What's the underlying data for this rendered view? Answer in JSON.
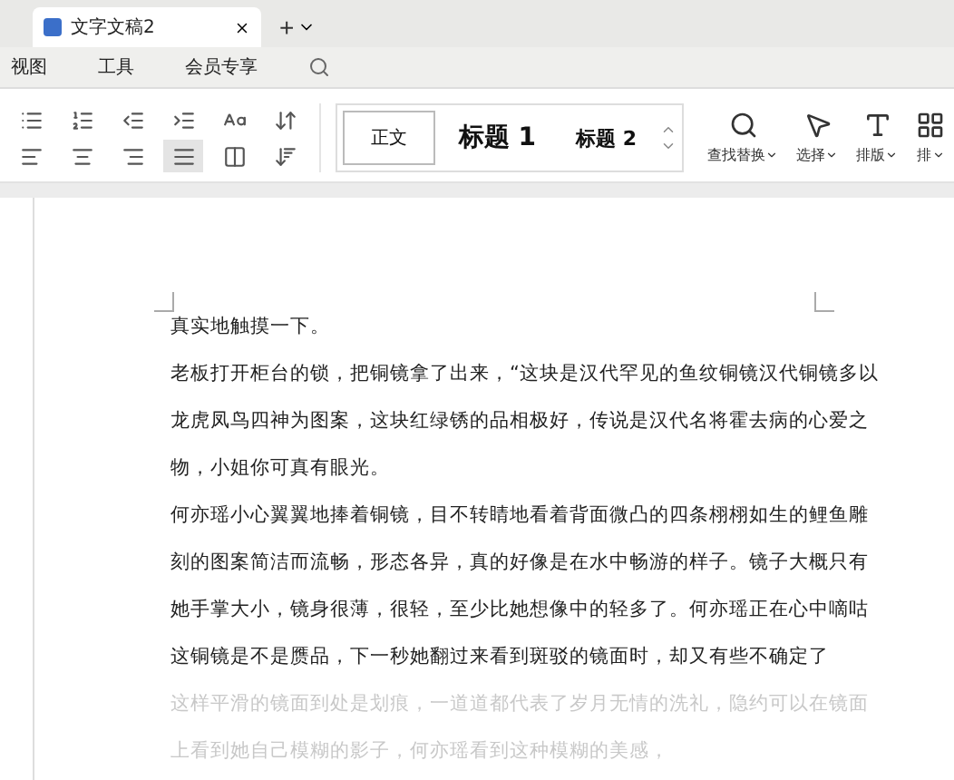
{
  "tabs": [
    {
      "label": "文字文稿2",
      "selected": true
    }
  ],
  "new_tab": "+",
  "menu": [
    {
      "label": "视图"
    },
    {
      "label": "工具"
    },
    {
      "label": "会员专享"
    }
  ],
  "styles": [
    {
      "label": "正文",
      "kind": "body",
      "selected": true
    },
    {
      "label": "标题 1",
      "kind": "h1",
      "selected": false
    },
    {
      "label": "标题 2",
      "kind": "h2",
      "selected": false
    }
  ],
  "tools": [
    {
      "label": "查找替换",
      "kind": "search"
    },
    {
      "label": "选择",
      "kind": "select"
    },
    {
      "label": "排版",
      "kind": "layout"
    },
    {
      "label": "排",
      "kind": "arrange"
    }
  ],
  "paragraphs": [
    {
      "text": "真实地触摸一下。",
      "faded": false
    },
    {
      "text": "老板打开柜台的锁，把铜镜拿了出来，“这块是汉代罕见的鱼纹铜镜汉代铜镜多以",
      "faded": false
    },
    {
      "text": "龙虎凤鸟四神为图案，这块红绿锈的品相极好，传说是汉代名将霍去病的心爱之",
      "faded": false
    },
    {
      "text": "物，小姐你可真有眼光。",
      "faded": false
    },
    {
      "text": "何亦瑶小心翼翼地捧着铜镜，目不转睛地看着背面微凸的四条栩栩如生的鲤鱼雕",
      "faded": false
    },
    {
      "text": "刻的图案简洁而流畅，形态各异，真的好像是在水中畅游的样子。镜子大概只有",
      "faded": false
    },
    {
      "text": "她手掌大小，镜身很薄，很轻，至少比她想像中的轻多了。何亦瑶正在心中嘀咕",
      "faded": false
    },
    {
      "text": "这铜镜是不是赝品，下一秒她翻过来看到斑驳的镜面时，却又有些不确定了",
      "faded": false
    },
    {
      "text": "这样平滑的镜面到处是划痕，一道道都代表了岁月无情的洗礼，隐约可以在镜面",
      "faded": true
    },
    {
      "text": "上看到她自己模糊的影子，何亦瑶看到这种模糊的美感，",
      "faded": true
    }
  ]
}
